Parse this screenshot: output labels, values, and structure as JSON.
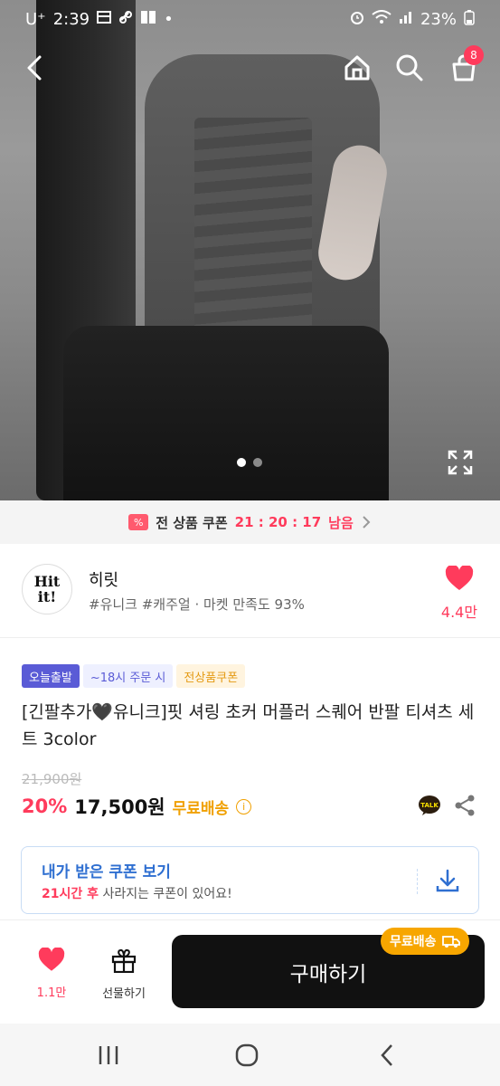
{
  "status": {
    "carrier": "U⁺",
    "time": "2:39",
    "battery": "23%"
  },
  "topnav": {
    "cart_count": "8",
    "icons": [
      "back-icon",
      "home-icon",
      "search-icon",
      "cart-icon"
    ]
  },
  "gallery": {
    "slides": 2,
    "active_index": 0
  },
  "coupon_strip": {
    "label": "전 상품 쿠폰",
    "timer": "21 : 20 : 17",
    "suffix": "남음",
    "ticket_glyph": "%"
  },
  "store": {
    "logo_text": "Hit it!",
    "name": "히릿",
    "tags": "#유니크 #캐주얼 · 마켓 만족도 93%",
    "like_count": "4.4만"
  },
  "product": {
    "badges": [
      "오늘출발",
      "~18시 주문 시",
      "전상품쿠폰"
    ],
    "title": "[긴팔추가🖤유니크]핏 셔링 초커 머플러 스퀘어 반팔 티셔츠 세트 3color",
    "original_price": "21,900원",
    "discount": "20%",
    "price": "17,500원",
    "shipping": "무료배송",
    "talk_label": "TALK"
  },
  "my_coupon": {
    "title": "내가 받은 쿠폰 보기",
    "time_bold": "21시간 후",
    "desc": " 사라지는 쿠폰이 있어요!"
  },
  "actionbar": {
    "wish_count": "1.1만",
    "gift_label": "선물하기",
    "buy_label": "구매하기",
    "ship_badge": "무료배송"
  },
  "colors": {
    "accent": "#ff3b5c",
    "coupon_blue": "#2f6fd1",
    "ship_orange": "#f7a600",
    "badge_purple": "#5a5bd6"
  }
}
